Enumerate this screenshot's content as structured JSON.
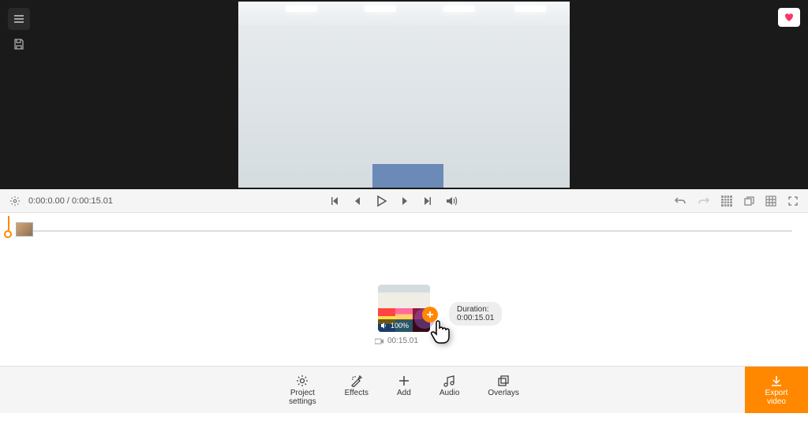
{
  "playback": {
    "current_time": "0:00:0.00",
    "total_time": "0:00:15.01",
    "separator": " / "
  },
  "media_clip": {
    "volume_label": "100%",
    "duration_short": "00:15.01",
    "duration_pill": "Duration: 0:00:15.01"
  },
  "toolbar": {
    "project_settings": "Project\nsettings",
    "effects": "Effects",
    "add": "Add",
    "audio": "Audio",
    "overlays": "Overlays",
    "export": "Export\nvideo"
  }
}
